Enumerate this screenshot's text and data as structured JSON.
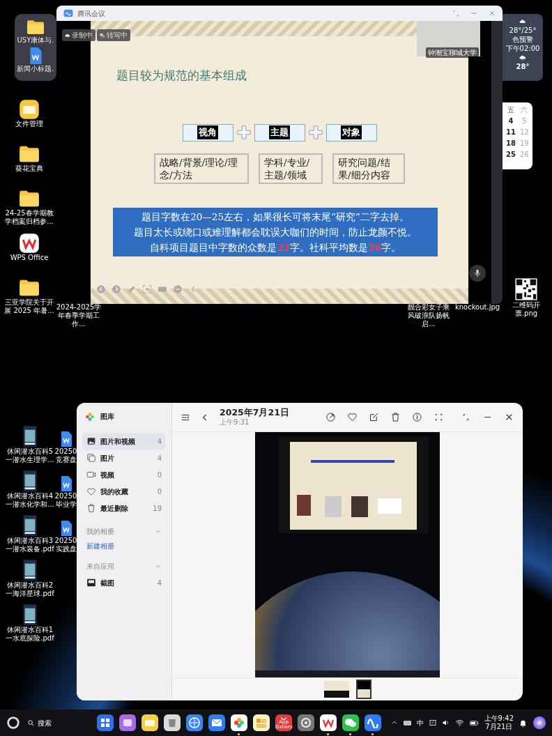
{
  "meeting_window": {
    "title": "腾讯会议",
    "badges": [
      {
        "label": "录制中",
        "kind": "recording"
      },
      {
        "label": "转写中",
        "kind": "transcribing"
      }
    ],
    "video_tile": {
      "name": "钟潮宝聊城大学"
    },
    "slide": {
      "title": "题目较为规范的基本组成",
      "headers": [
        "视角",
        "主题",
        "对象"
      ],
      "details": [
        "战略/背景/理论/理念/方法",
        "学科/专业/主题/领域",
        "研究问题/结果/细分内容"
      ],
      "note_lines": [
        [
          {
            "text": "题目字数在20—25左右，如果很长可将末尾“研究”二字去掉。",
            "highlight": false
          }
        ],
        [
          {
            "text": "题目太长或绕口或难理解都会耽误大咖们的时间，防止龙颜不悦。",
            "highlight": false
          }
        ],
        [
          {
            "text": "自科项目题目中字数的众数是",
            "highlight": false
          },
          {
            "text": "22",
            "highlight": true
          },
          {
            "text": "字。社科平均数是",
            "highlight": false
          },
          {
            "text": "26",
            "highlight": true
          },
          {
            "text": "字。",
            "highlight": false
          }
        ]
      ]
    }
  },
  "weather_widget": {
    "temperature_range": "28°/25°",
    "alert": "色预警",
    "forecast_time": "下午02:00",
    "forecast_temp": "28°"
  },
  "calendar_widget": {
    "columns": [
      {
        "weekday": "五",
        "weekend": false,
        "days": [
          "4",
          "11",
          "18",
          "25"
        ]
      },
      {
        "weekday": "六",
        "weekend": true,
        "days": [
          "5",
          "12",
          "19",
          "26"
        ]
      }
    ]
  },
  "desktop_panel": [
    {
      "label": "USY康体与.",
      "kind": "folder"
    },
    {
      "label": "新闻小标题.",
      "kind": "word"
    }
  ],
  "desktop_left": [
    {
      "label": "文件管理",
      "kind": "files"
    },
    {
      "label": "葵花宝典",
      "kind": "folder"
    },
    {
      "label": "24-25春学期教学档案归档参...",
      "kind": "folder"
    },
    {
      "label": "WPS Office",
      "kind": "wps"
    },
    {
      "label": "三亚学院关于开展 2025 年暑...",
      "kind": "folder"
    }
  ],
  "desktop_captions": [
    "2024-2025学年春季学期工作...",
    "靓合彩女子乘风破浪队扬帆启...",
    "knockout.jpg"
  ],
  "desktop_right": [
    {
      "label": "二维码开票.png",
      "kind": "qr"
    }
  ],
  "desktop_lower": [
    {
      "label": "休闲潜水百科5一潜水生理学...",
      "kind": "pdf"
    },
    {
      "label": "休闲潜水百科4一潜水化学和...",
      "kind": "pdf"
    },
    {
      "label": "休闲潜水百科3一潜水装备.pdf",
      "kind": "pdf"
    },
    {
      "label": "休闲潜水百科2一海洋星球.pdf",
      "kind": "pdf"
    },
    {
      "label": "休闲潜水百科1一水底探险.pdf",
      "kind": "pdf"
    }
  ],
  "desktop_lower_second": [
    {
      "label": "20250 竞赛盘",
      "kind": "word"
    },
    {
      "label": "20250 毕业学",
      "kind": "word"
    },
    {
      "label": "20250 实践盘",
      "kind": "word"
    }
  ],
  "gallery_window": {
    "app_name": "图库",
    "nav_items": [
      {
        "label": "图片和视频",
        "count": "4",
        "kind": "all",
        "selected": true
      },
      {
        "label": "图片",
        "count": "4",
        "kind": "images",
        "selected": false
      },
      {
        "label": "视频",
        "count": "0",
        "kind": "video",
        "selected": false
      },
      {
        "label": "我的收藏",
        "count": "0",
        "kind": "favorites",
        "selected": false
      },
      {
        "label": "最近删除",
        "count": "19",
        "kind": "trash",
        "selected": false
      }
    ],
    "sections": [
      {
        "heading": "我的相册",
        "expanded": true,
        "link": "新建相册"
      },
      {
        "heading": "来自应用",
        "expanded": true,
        "albums": [
          {
            "label": "截图",
            "count": "4"
          }
        ]
      }
    ],
    "date": "2025年7月21日",
    "time": "上午9:31",
    "thumbnails": [
      {
        "selected": false
      },
      {
        "selected": true
      }
    ]
  },
  "taskbar": {
    "search_label": "搜索",
    "apps": [
      {
        "kind": "grid",
        "running": false
      },
      {
        "kind": "notes",
        "running": false
      },
      {
        "kind": "files",
        "running": false
      },
      {
        "kind": "trash",
        "running": false
      },
      {
        "kind": "browser",
        "running": false
      },
      {
        "kind": "mail",
        "running": false
      },
      {
        "kind": "gallery",
        "running": true
      },
      {
        "kind": "cards",
        "running": false
      },
      {
        "kind": "appstore",
        "label": "App Gallery",
        "running": false
      },
      {
        "kind": "settings",
        "running": false
      },
      {
        "kind": "wps",
        "running": true
      },
      {
        "kind": "chat",
        "running": true
      },
      {
        "kind": "meeting",
        "running": true
      }
    ],
    "ime": "中",
    "time": "上午9:42",
    "date": "7月21日"
  }
}
